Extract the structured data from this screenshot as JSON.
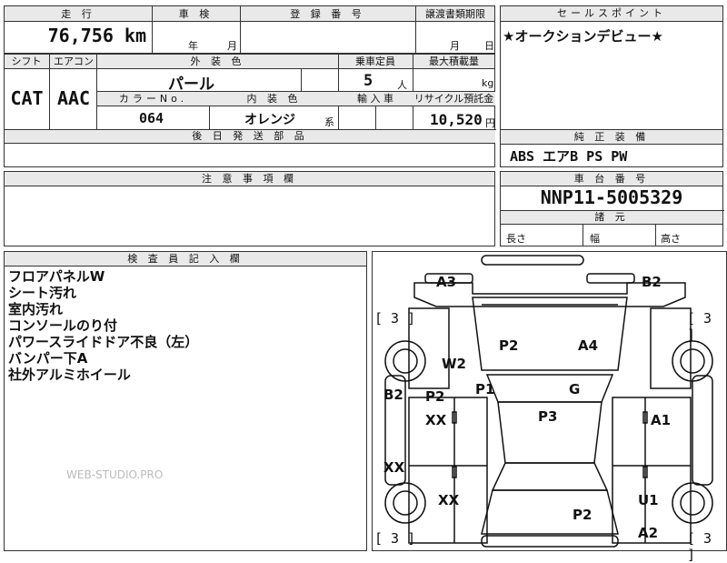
{
  "top": {
    "mileage_header": "走 行",
    "shaken_header": "車 検",
    "reg_header": "登 録 番 号",
    "transfer_header": "譲渡書類期限",
    "sales_header": "セールスポイント",
    "mileage_value": "76,756",
    "mileage_unit": "km",
    "year_label": "年",
    "month_label": "月",
    "tr_month": "月",
    "tr_day": "日",
    "sales_point": "★オークションデビュー★"
  },
  "spec": {
    "shift_header": "シフト",
    "ac_header": "エアコン",
    "ext_color_header": "外 装 色",
    "capacity_header": "乗車定員",
    "max_load_header": "最大積載量",
    "shift_value": "CAT",
    "ac_value": "AAC",
    "ext_color_value": "パール",
    "capacity_value": "5",
    "capacity_unit": "人",
    "load_unit": "kg",
    "color_no_header": "カラーNo.",
    "int_color_header": "内 装 色",
    "import_header": "輸 入 車",
    "recycle_header": "リサイクル預託金",
    "color_no_value": "064",
    "int_color_value": "オレンジ",
    "int_color_suffix": "系",
    "recycle_value": "10,520",
    "recycle_unit": "円",
    "later_parts_header": "後 日 発 送 部 品"
  },
  "equipment": {
    "header": "純 正 装 備",
    "value": "ABS エアB PS PW"
  },
  "caution": {
    "header": "注 意 事 項 欄"
  },
  "chassis": {
    "header": "車 台 番 号",
    "value": "NNP11-5005329",
    "dims_header": "諸 元",
    "length_label": "長さ",
    "width_label": "幅",
    "height_label": "高さ"
  },
  "inspector": {
    "header": "検 査 員 記 入 欄",
    "notes": [
      "フロアパネルW",
      "シート汚れ",
      "室内汚れ",
      "コンソールのり付",
      "パワースライドドア不良（左）",
      "バンパー下A",
      "社外アルミホイール"
    ]
  },
  "watermark": "WEB-STUDIO.PRO",
  "diagram": {
    "marks": {
      "a3": "A3",
      "b2_top": "B2",
      "p2_hood": "P2",
      "a4": "A4",
      "w2": "W2",
      "p1": "P1",
      "g": "G",
      "b2_left": "B2",
      "p2_left": "P2",
      "xx_left1": "XX",
      "p3": "P3",
      "a1": "A1",
      "xx_left2": "XX",
      "xx_left3": "XX",
      "u1": "U1",
      "p2_rear": "P2",
      "a2": "A2"
    },
    "tire_tl": "[ 3 ]",
    "tire_tr": "[ 3 ]",
    "tire_bl": "[ 3 ]",
    "tire_br": "[ 3 ]"
  }
}
